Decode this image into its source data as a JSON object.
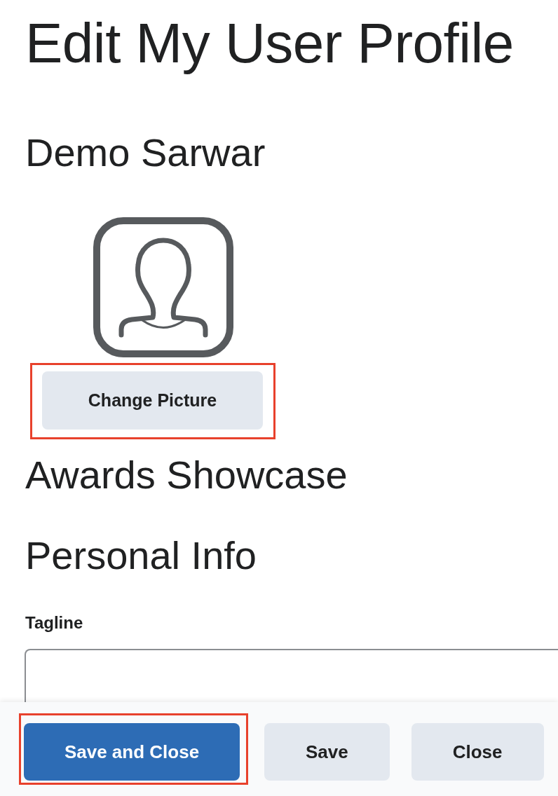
{
  "page": {
    "title": "Edit My User Profile"
  },
  "profile": {
    "name": "Demo Sarwar",
    "change_picture": {
      "label": "Change Picture",
      "highlighted": true
    }
  },
  "sections": [
    {
      "heading": "Awards Showcase"
    },
    {
      "heading": "Personal Info",
      "fields": [
        {
          "label": "Tagline"
        }
      ]
    }
  ],
  "footer": {
    "buttons": [
      {
        "label": "Save and Close",
        "kind": "primary",
        "highlighted": true
      },
      {
        "label": "Save",
        "kind": "secondary",
        "highlighted": false
      },
      {
        "label": "Close",
        "kind": "secondary",
        "highlighted": false
      }
    ]
  }
}
